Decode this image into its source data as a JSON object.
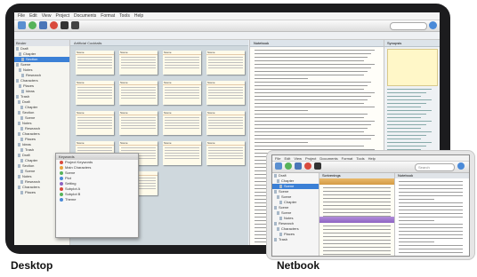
{
  "labels": {
    "desktop": "Desktop",
    "netbook": "Netbook"
  },
  "desktop": {
    "menu": [
      "File",
      "Edit",
      "View",
      "Project",
      "Documents",
      "Format",
      "Tools",
      "Help"
    ],
    "corkboard_title": "Artificial Cocktails",
    "editor_title": "Notebook",
    "inspector_title": "Synopsis",
    "popup_title": "Keywords",
    "binder_items": [
      "Draft",
      "Chapter",
      "Section",
      "Scene",
      "Notes",
      "Research",
      "Characters",
      "Places",
      "Ideas",
      "Trash"
    ],
    "popup_items": [
      "Project Keywords",
      "Main Characters",
      "Scene",
      "Plot",
      "Setting",
      "Subplot A",
      "Subplot B",
      "Theme"
    ],
    "cards": [
      "Scene",
      "Scene",
      "Scene",
      "Scene",
      "Scene",
      "Scene",
      "Scene",
      "Scene",
      "Scene",
      "Scene",
      "Scene",
      "Scene",
      "Scene",
      "Scene",
      "Scene",
      "Scene",
      "Scene",
      "Scene"
    ]
  },
  "netbook": {
    "menu": [
      "File",
      "Edit",
      "View",
      "Project",
      "Documents",
      "Format",
      "Tools",
      "Help"
    ],
    "search_placeholder": "Search",
    "scrivenings_title": "Scrivenings",
    "doc_title": "Notebook",
    "binder_items": [
      "Draft",
      "Chapter",
      "Scene",
      "Scene",
      "Scene",
      "Chapter",
      "Scene",
      "Scene",
      "Notes",
      "Research",
      "Characters",
      "Places",
      "Trash"
    ]
  },
  "colors": {
    "desk_frame": "#1c1c1e",
    "card_bg": "#fffbea",
    "selection": "#3b80d6",
    "separator_orange": "#d49b43",
    "separator_purple": "#8d63c3"
  }
}
